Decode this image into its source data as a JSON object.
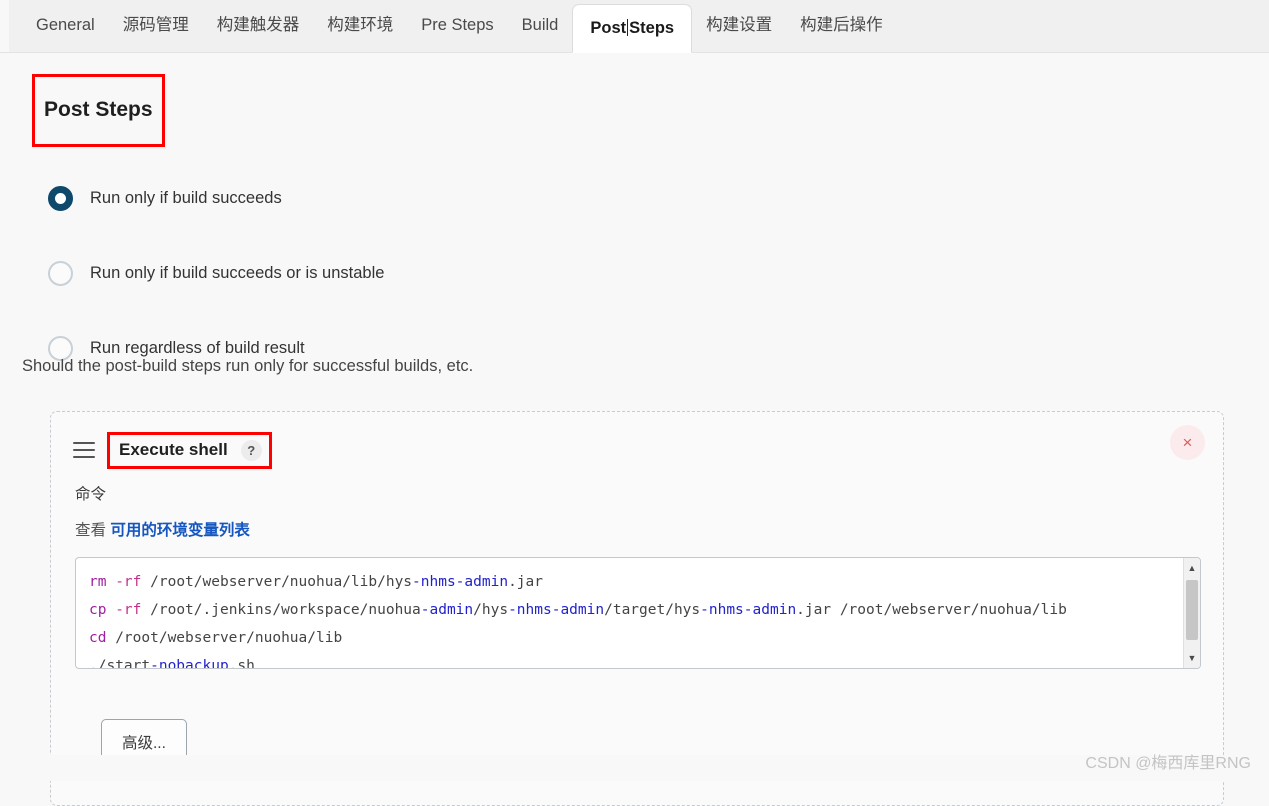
{
  "tabs": [
    {
      "label": "General",
      "active": false
    },
    {
      "label": "源码管理",
      "active": false
    },
    {
      "label": "构建触发器",
      "active": false
    },
    {
      "label": "构建环境",
      "active": false
    },
    {
      "label": "Pre Steps",
      "active": false
    },
    {
      "label": "Build",
      "active": false
    },
    {
      "label": "Post Steps",
      "active": true
    },
    {
      "label": "构建设置",
      "active": false
    },
    {
      "label": "构建后操作",
      "active": false
    }
  ],
  "page": {
    "title": "Post Steps"
  },
  "radios": [
    {
      "label": "Run only if build succeeds",
      "selected": true
    },
    {
      "label": "Run only if build succeeds or is unstable",
      "selected": false
    },
    {
      "label": "Run regardless of build result",
      "selected": false
    }
  ],
  "help_text": "Should the post-build steps run only for successful builds, etc.",
  "step": {
    "title": "Execute shell",
    "help_badge": "?",
    "close_label": "×",
    "command_label": "命令",
    "env_prefix": "查看",
    "env_link": "可用的环境变量列表",
    "code_lines": [
      {
        "tokens": [
          {
            "t": "rm",
            "c": "cmd"
          },
          {
            "t": " ",
            "c": "pl"
          },
          {
            "t": "-rf",
            "c": "flag"
          },
          {
            "t": " /root/webserver/nuohua/lib/hys",
            "c": "pl"
          },
          {
            "t": "-nhms-admin",
            "c": "id"
          },
          {
            "t": ".jar",
            "c": "pl"
          }
        ]
      },
      {
        "tokens": [
          {
            "t": "cp",
            "c": "cmd"
          },
          {
            "t": " ",
            "c": "pl"
          },
          {
            "t": "-rf",
            "c": "flag"
          },
          {
            "t": " /root/.jenkins/workspace/nuohua",
            "c": "pl"
          },
          {
            "t": "-admin",
            "c": "id"
          },
          {
            "t": "/hys",
            "c": "pl"
          },
          {
            "t": "-nhms-admin",
            "c": "id"
          },
          {
            "t": "/target/hys",
            "c": "pl"
          },
          {
            "t": "-nhms-admin",
            "c": "id"
          },
          {
            "t": ".jar /root/webserver/nuohua/lib",
            "c": "pl"
          }
        ]
      },
      {
        "tokens": [
          {
            "t": "cd",
            "c": "cmd"
          },
          {
            "t": " /root/webserver/nuohua/lib",
            "c": "pl"
          }
        ]
      },
      {
        "tokens": [
          {
            "t": "./start",
            "c": "pl"
          },
          {
            "t": "-nobackup",
            "c": "id"
          },
          {
            "t": ".sh",
            "c": "pl"
          }
        ]
      }
    ],
    "scroll_up": "▲",
    "scroll_down": "▼",
    "advanced_label": "高级..."
  },
  "watermark": "CSDN @梅西库里RNG",
  "colors": {
    "page_bg": "#f8f8f8",
    "tabbar_bg": "#f0f0f0",
    "active_tab_bg": "#ffffff",
    "radio_selected": "#0e486b",
    "radio_unselected": "#c9d0d6",
    "annotation_red": "#fe0000",
    "link_blue": "#1556c0",
    "close_red": "#e05a5a",
    "code_cmd": "#a020a0",
    "code_flag": "#c4318c",
    "code_id": "#2222cc"
  }
}
